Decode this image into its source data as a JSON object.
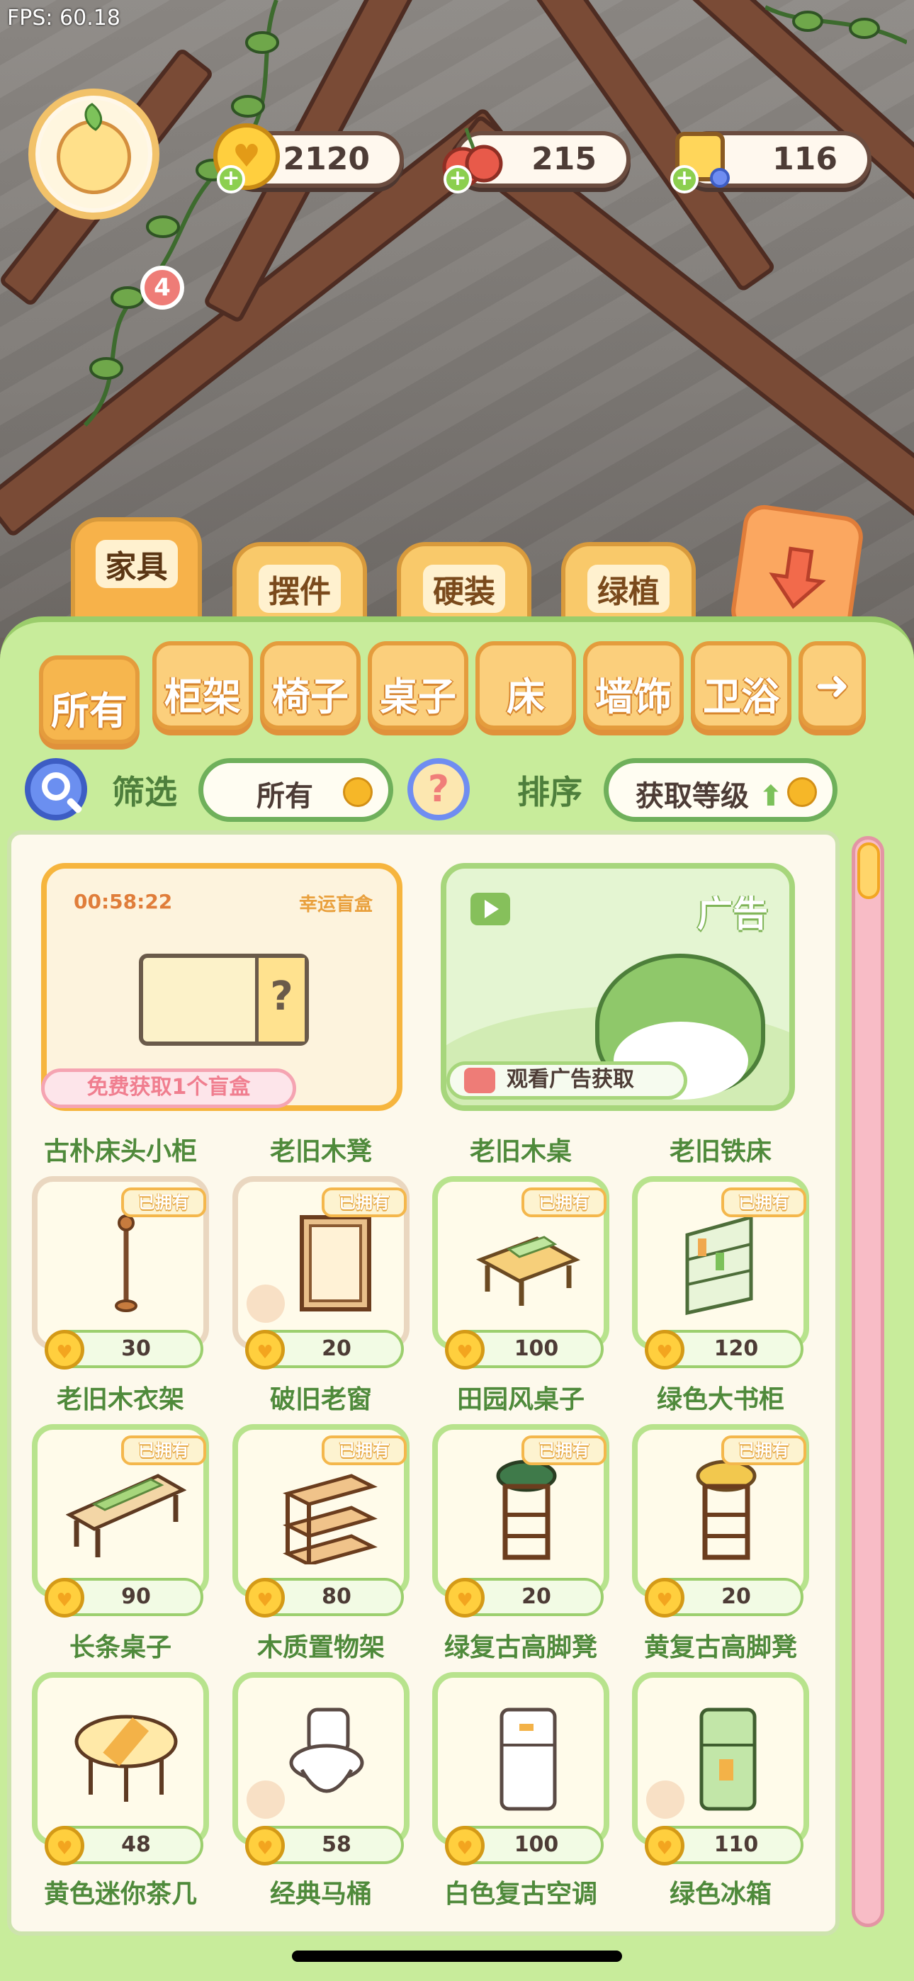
{
  "status": {
    "fps": "FPS: 60.18"
  },
  "player": {
    "level": "4"
  },
  "resources": [
    {
      "name": "coin-icon",
      "value": "2120",
      "color": "#ffcf3e"
    },
    {
      "name": "cherry-icon",
      "value": "215",
      "color": "#e85a4a"
    },
    {
      "name": "ticket-icon",
      "value": "116",
      "color": "#ffd65a"
    }
  ],
  "categories": [
    {
      "label": "家具",
      "active": true
    },
    {
      "label": "摆件",
      "active": false
    },
    {
      "label": "硬装",
      "active": false
    },
    {
      "label": "绿植",
      "active": false
    }
  ],
  "subtabs": [
    {
      "label": "所有",
      "active": true
    },
    {
      "label": "柜架"
    },
    {
      "label": "椅子"
    },
    {
      "label": "桌子"
    },
    {
      "label": "床"
    },
    {
      "label": "墙饰"
    },
    {
      "label": "卫浴"
    }
  ],
  "filter": {
    "filter_label": "筛选",
    "filter_value": "所有",
    "help_symbol": "?",
    "sort_label": "排序",
    "sort_value": "获取等级",
    "sort_arrow": "⬆"
  },
  "blind_box": {
    "timer": "00:58:22",
    "tag": "幸运盲盒",
    "question": "?",
    "free_label": "免费获取1个盲盒"
  },
  "ad": {
    "title": "广告",
    "watch_label": "观看广告获取"
  },
  "items": [
    {
      "name": "古朴床头小柜",
      "owned": "已拥有",
      "price": "30",
      "art": "coat-rack"
    },
    {
      "name": "老旧木凳",
      "owned": "已拥有",
      "price": "20",
      "art": "window"
    },
    {
      "name": "老旧木桌",
      "owned": "已拥有",
      "price": "100",
      "art": "table"
    },
    {
      "name": "老旧铁床",
      "owned": "已拥有",
      "price": "120",
      "art": "bookcase"
    },
    {
      "name": "老旧木衣架",
      "owned": "已拥有",
      "price": "90",
      "art": "long-table"
    },
    {
      "name": "破旧老窗",
      "owned": "已拥有",
      "price": "80",
      "art": "shelf"
    },
    {
      "name": "田园风桌子",
      "owned": "已拥有",
      "price": "20",
      "art": "stool-green"
    },
    {
      "name": "绿色大书柜",
      "owned": "已拥有",
      "price": "20",
      "art": "stool-yellow"
    },
    {
      "name": "长条桌子",
      "owned": "",
      "price": "48",
      "art": "round-table"
    },
    {
      "name": "木质置物架",
      "owned": "",
      "price": "58",
      "art": "toilet"
    },
    {
      "name": "绿复古高脚凳",
      "owned": "",
      "price": "100",
      "art": "fridge-white"
    },
    {
      "name": "黄复古高脚凳",
      "owned": "",
      "price": "110",
      "art": "fridge-green"
    }
  ],
  "bottom_names": [
    "黄色迷你茶几",
    "经典马桶",
    "白色复古空调",
    "绿色冰箱"
  ]
}
